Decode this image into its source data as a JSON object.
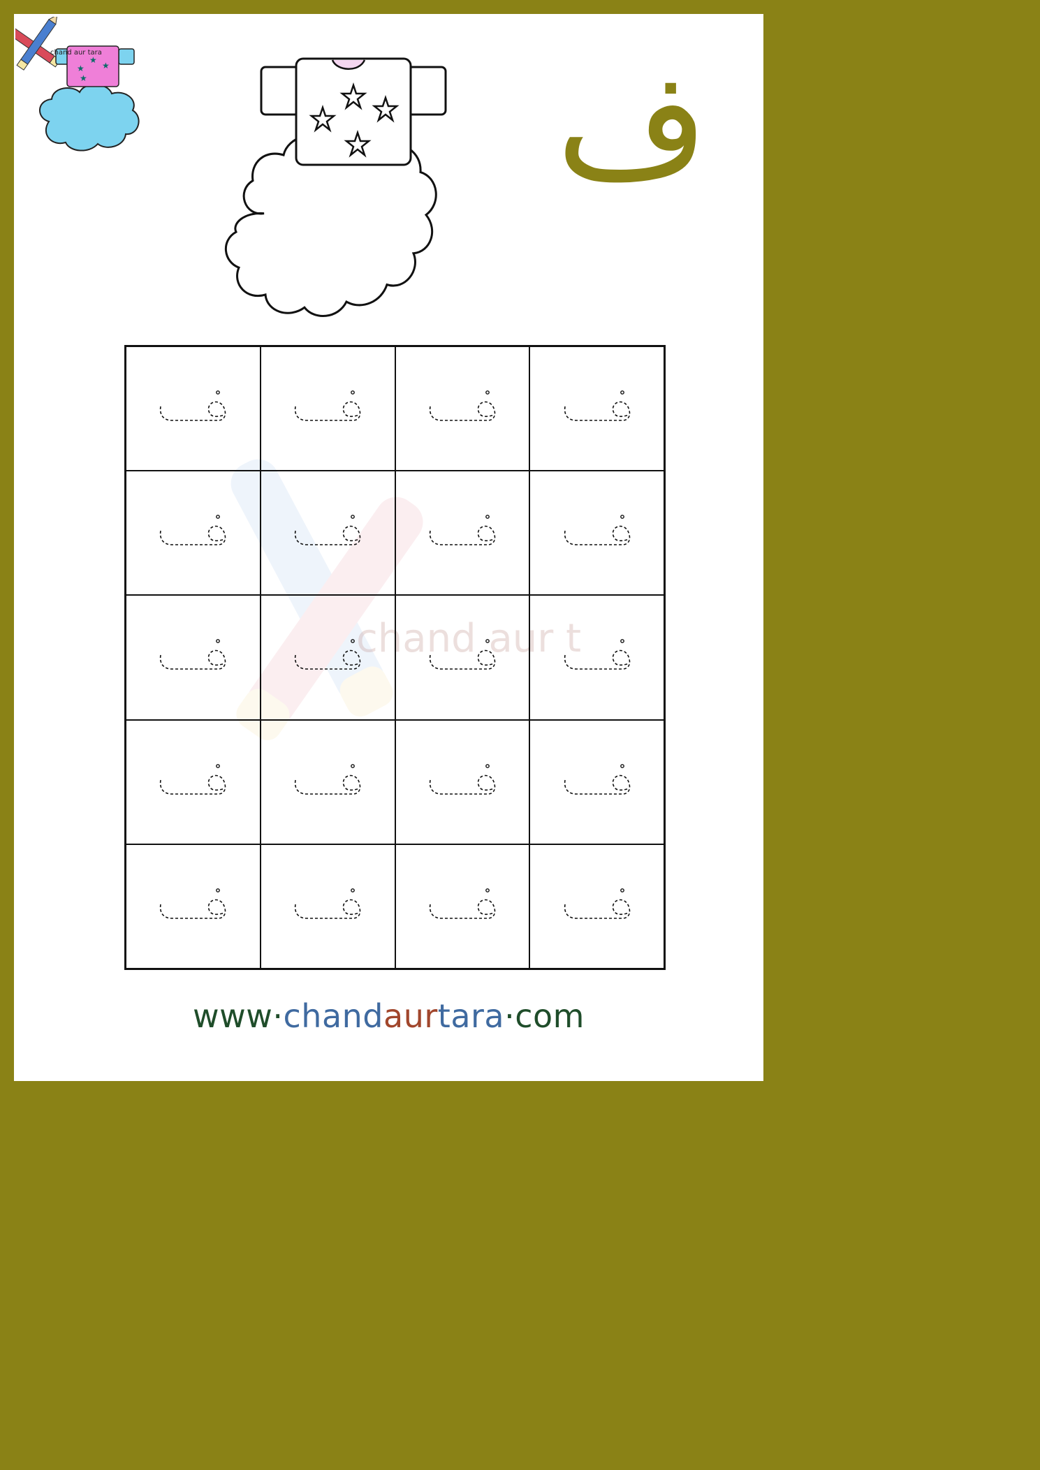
{
  "logo": {
    "text": "chand aur tara",
    "icon": "pencils-shirt-cloud-logo"
  },
  "illustration": {
    "name": "shirt-on-cloud-coloring-outline",
    "stars": 4
  },
  "letter": "ف",
  "colors": {
    "border": "#8a8216",
    "letter": "#8a8216",
    "url_www": "#1f4d2a",
    "url_chand": "#3f6aa0",
    "url_aur": "#a1462c",
    "url_tara": "#3f6aa0",
    "url_com": "#1f4d2a"
  },
  "practice_grid": {
    "rows": 5,
    "columns": 4,
    "glyph": "ف",
    "style": "dashed-tracing"
  },
  "watermark": {
    "text": "chand aur t"
  },
  "footer": {
    "www": "www",
    "dot1": "·",
    "chand": "chand",
    "aur": "aur",
    "tara": "tara",
    "dot2": "·",
    "com": "com"
  }
}
